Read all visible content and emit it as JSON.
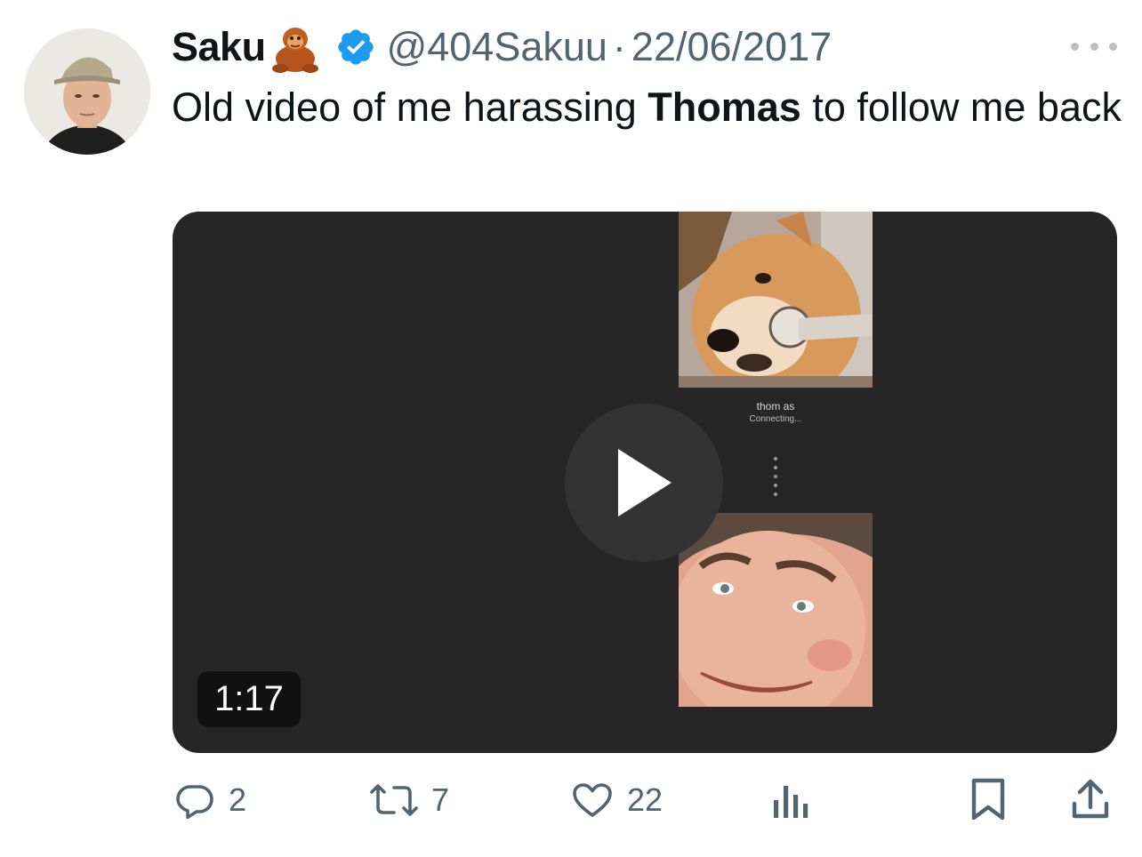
{
  "tweet": {
    "display_name": "Saku",
    "name_emoji": "orangutan",
    "handle": "@404Sakuu",
    "separator": "·",
    "date": "22/06/2017",
    "text_before": "Old video of me harassing ",
    "text_bold": "Thomas",
    "text_after": " to follow me back"
  },
  "media": {
    "caller_name": "thom as",
    "caller_status": "Connecting...",
    "duration": "1:17"
  },
  "actions": {
    "replies": "2",
    "retweets": "7",
    "likes": "22"
  },
  "icons": {
    "avatar": "avatar",
    "verified": "verified-badge-icon",
    "more": "more-icon",
    "play": "play-icon",
    "reply": "reply-icon",
    "retweet": "retweet-icon",
    "like": "heart-icon",
    "views": "views-icon",
    "bookmark": "bookmark-icon",
    "share": "share-icon"
  },
  "colors": {
    "verified": "#1d9bf0",
    "secondary_text": "#536471",
    "media_background": "#262626"
  }
}
